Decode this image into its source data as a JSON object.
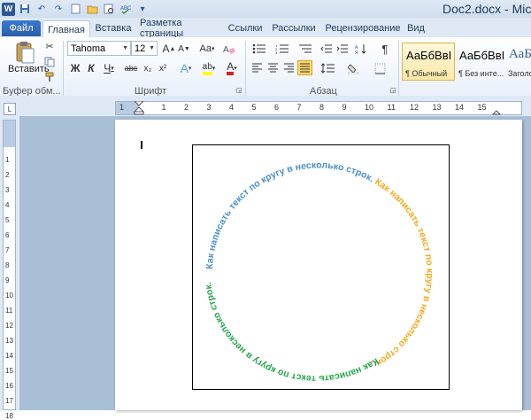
{
  "window": {
    "title": "Doc2.docx - Mic",
    "app_logo": "W"
  },
  "quick_access": [
    "save-icon",
    "undo-icon",
    "redo-icon",
    "new-icon",
    "open-icon",
    "print-preview-icon",
    "spelling-icon",
    "customize-icon"
  ],
  "tabs": [
    {
      "label": "Файл",
      "key": "file"
    },
    {
      "label": "Главная",
      "key": "home"
    },
    {
      "label": "Вставка",
      "key": "insert"
    },
    {
      "label": "Разметка страницы",
      "key": "layout"
    },
    {
      "label": "Ссылки",
      "key": "refs"
    },
    {
      "label": "Рассылки",
      "key": "mail"
    },
    {
      "label": "Рецензирование",
      "key": "review"
    },
    {
      "label": "Вид",
      "key": "view"
    }
  ],
  "ribbon": {
    "clipboard": {
      "paste_label": "Вставить",
      "group_label": "Буфер обм..."
    },
    "font": {
      "font_name": "Tahoma",
      "font_size": "12",
      "grow": "A",
      "shrink": "A",
      "case": "Aa",
      "bold": "Ж",
      "italic": "К",
      "underline": "Ч",
      "strike": "abc",
      "subscript": "x₂",
      "superscript": "x²",
      "effects": "A",
      "highlight": "ab",
      "color": "A",
      "group_label": "Шрифт"
    },
    "paragraph": {
      "group_label": "Абзац",
      "pilcrow": "¶"
    },
    "styles": [
      {
        "sample": "АаБбВвІ",
        "name": "¶ Обычный"
      },
      {
        "sample": "АаБбВвІ",
        "name": "¶ Без инте..."
      },
      {
        "sample": "АаБ",
        "name": "Заголо"
      }
    ]
  },
  "ruler": {
    "corner": "L",
    "h_numbers": [
      "1",
      "2",
      "1",
      "2",
      "3",
      "4",
      "5",
      "6",
      "7",
      "8",
      "9",
      "10",
      "11",
      "12",
      "13",
      "14",
      "15"
    ],
    "v_numbers": [
      "1",
      "2",
      "3",
      "4",
      "5",
      "6",
      "7",
      "8",
      "9",
      "10",
      "11",
      "12",
      "13",
      "14",
      "15",
      "16",
      "17",
      "18"
    ]
  },
  "document": {
    "circle_text_blue": "Как написать текст по кругу в несколько строк.",
    "circle_text_orange": "Как написать текст по кругу в несколько строк.",
    "circle_text_green": "Как написать текст по кругу в несколько строк.",
    "colors": {
      "blue": "#4a90c9",
      "orange": "#f7a81b",
      "green": "#24a84a"
    }
  }
}
